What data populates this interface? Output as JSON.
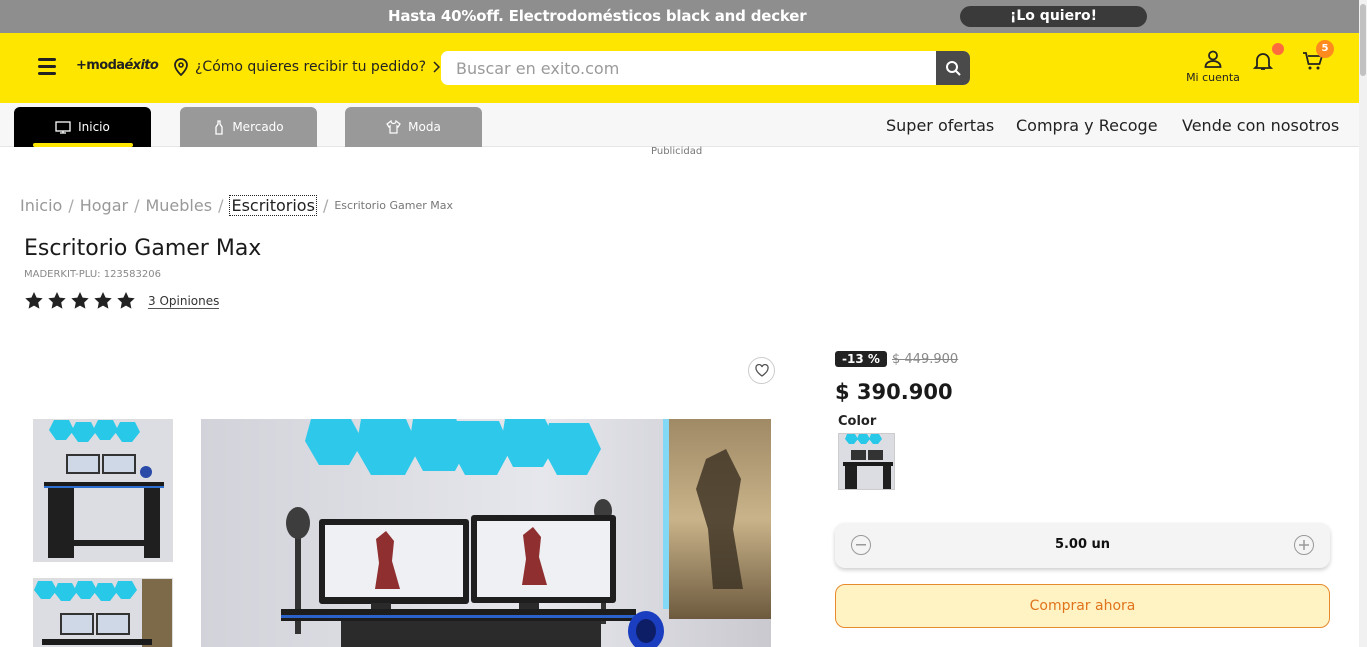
{
  "promo": {
    "text": "Hasta 40%off. Electrodomésticos black and decker",
    "button": "¡Lo quiero!"
  },
  "header": {
    "logo_prefix": "+moda",
    "logo_brand": "éxito",
    "delivery_prompt": "¿Cómo quieres recibir tu pedido?",
    "search_placeholder": "Buscar en exito.com",
    "account_label": "Mi cuenta",
    "cart_count": "5"
  },
  "nav": {
    "tabs": [
      {
        "label": "Inicio",
        "icon": "monitor-icon",
        "active": true
      },
      {
        "label": "Mercado",
        "icon": "bottle-icon",
        "active": false
      },
      {
        "label": "Moda",
        "icon": "shirt-icon",
        "active": false
      }
    ],
    "links": [
      "Super ofertas",
      "Compra y Recoge",
      "Vende con nosotros"
    ]
  },
  "ad_label": "Publicidad",
  "breadcrumb": [
    "Inicio",
    "Hogar",
    "Muebles",
    "Escritorios",
    "Escritorio Gamer Max"
  ],
  "product": {
    "title": "Escritorio Gamer Max",
    "sku": "MADERKIT-PLU: 123583206",
    "rating": 5,
    "reviews": "3 Opiniones",
    "discount": "-13 %",
    "old_price": "$ 449.900",
    "price": "$ 390.900",
    "color_label": "Color",
    "quantity": "5.00 un",
    "buy_label": "Comprar ahora"
  },
  "colors": {
    "brand_yellow": "#ffe600",
    "promo_gray": "#8e8e8e",
    "buy_accent": "#e78a2e",
    "cart_badge": "#ff8a1e"
  }
}
